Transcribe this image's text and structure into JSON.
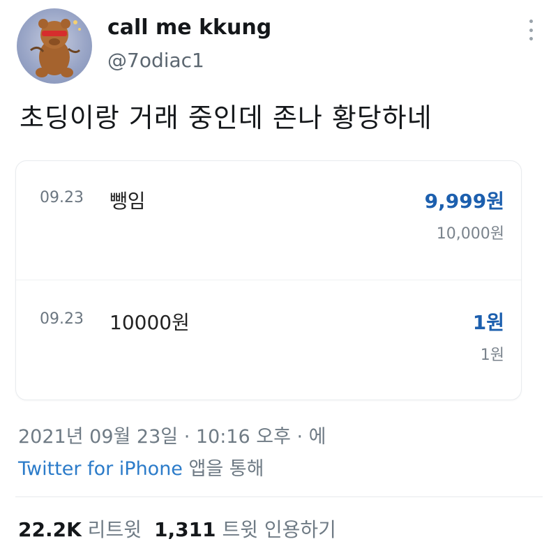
{
  "author": {
    "display_name": "call me kkung",
    "handle": "@7odiac1"
  },
  "tweet": {
    "text": "초딩이랑 거래 중인데 존나 황당하네"
  },
  "transactions": [
    {
      "date": "09.23",
      "description": "뺑임",
      "amount": "9,999원",
      "balance": "10,000원"
    },
    {
      "date": "09.23",
      "description": "10000원",
      "amount": "1원",
      "balance": "1원"
    }
  ],
  "meta": {
    "timestamp": "2021년 09월 23일 · 10:16 오후 · 에",
    "client": "Twitter for iPhone",
    "via": " 앱을 통해"
  },
  "stats": {
    "retweets_count": "22.2K",
    "retweets_label": " 리트윗",
    "quotes_count": "1,311",
    "quotes_label": " 트윗 인용하기"
  },
  "colors": {
    "amount": "#1c5fae",
    "link": "#2b7bc9"
  }
}
